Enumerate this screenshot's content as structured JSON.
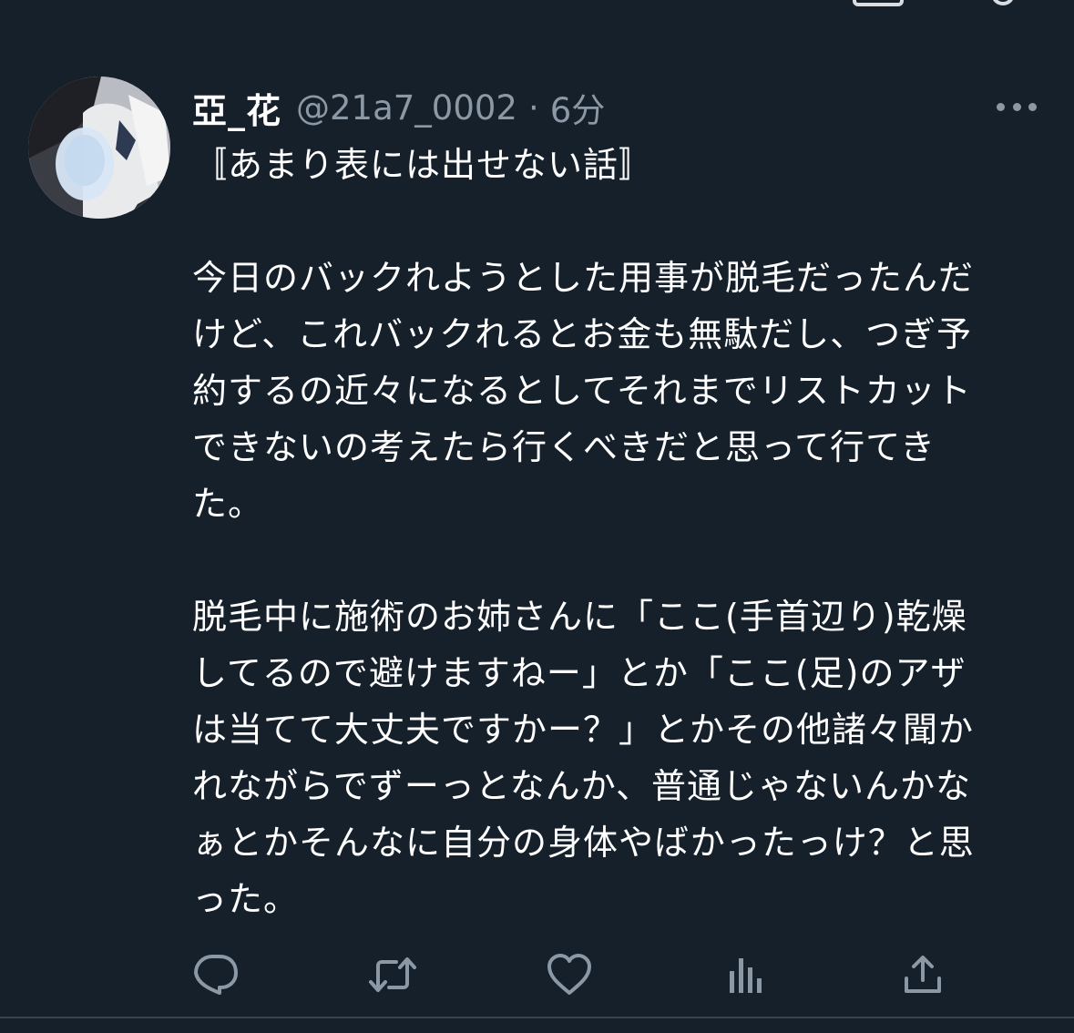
{
  "tweet": {
    "display_name": "亞_花",
    "handle": "@21a7_0002",
    "separator": "·",
    "time": "6分",
    "paragraphs": [
      "〚あまり表には出せない話〛",
      "今日のバックれようとした用事が脱毛だったんだけど、これバックれるとお金も無駄だし、つぎ予約するの近々になるとしてそれまでリストカットできないの考えたら行くべきだと思って行てきた。",
      "脱毛中に施術のお姉さんに「ここ(手首辺り)乾燥してるので避けますねー」とか「ここ(足)のアザは当てて大丈夫ですかー？」とかその他諸々聞かれながらでずーっとなんか、普通じゃないんかなぁとかそんなに自分の身体やばかったっけ？と思った。"
    ],
    "lines": {
      "p1": [
        "〚あまり表には出せない話〛"
      ],
      "p2": [
        "今日のバックれようとした用事が脱毛だったんだ",
        "けど、これバックれるとお金も無駄だし、つぎ予",
        "約するの近々になるとしてそれまでリストカット",
        "できないの考えたら行くべきだと思って行てき",
        "た。"
      ],
      "p3": [
        "脱毛中に施術のお姉さんに「ここ(手首辺り)乾燥",
        "してるので避けますねー」とか「ここ(足)のアザ",
        "は当てて大丈夫ですかー？」とかその他諸々聞か",
        "れながらでずーっとなんか、普通じゃないんかな",
        "ぁとかそんなに自分の身体やばかったっけ？と思",
        "った。"
      ]
    }
  },
  "actions": {
    "reply_icon": "reply-icon",
    "retweet_icon": "retweet-icon",
    "like_icon": "heart-icon",
    "views_icon": "analytics-icon",
    "share_icon": "share-icon"
  },
  "colors": {
    "background": "#15202b",
    "text_primary": "#ffffff",
    "text_secondary": "#8b98a5",
    "divider": "#38444d"
  }
}
